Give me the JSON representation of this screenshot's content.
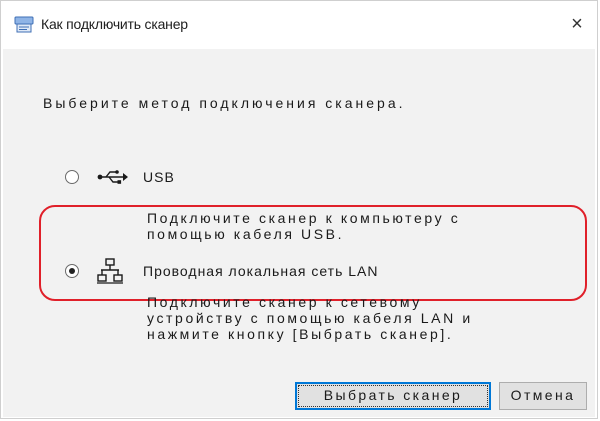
{
  "window": {
    "title": "Как подключить сканер",
    "close_glyph": "×"
  },
  "main": {
    "instruction": "Выберите метод подключения сканера."
  },
  "options": [
    {
      "label": "USB",
      "icon": "usb-icon",
      "selected": false,
      "description": [
        "Подключите сканер к компьютеру с",
        "помощью кабеля USB."
      ]
    },
    {
      "label": "Проводная локальная сеть LAN",
      "icon": "network-lan-icon",
      "selected": true,
      "description": [
        "Подключите сканер к сетевому",
        "устройству с помощью кабеля LAN и",
        "нажмите кнопку [Выбрать сканер]."
      ]
    }
  ],
  "buttons": {
    "select_scanner": "Выбрать сканер",
    "cancel": "Отмена"
  },
  "colors": {
    "highlight": "#e0202a",
    "focus_border": "#0078d7",
    "client_bg": "#f2f2f2"
  }
}
